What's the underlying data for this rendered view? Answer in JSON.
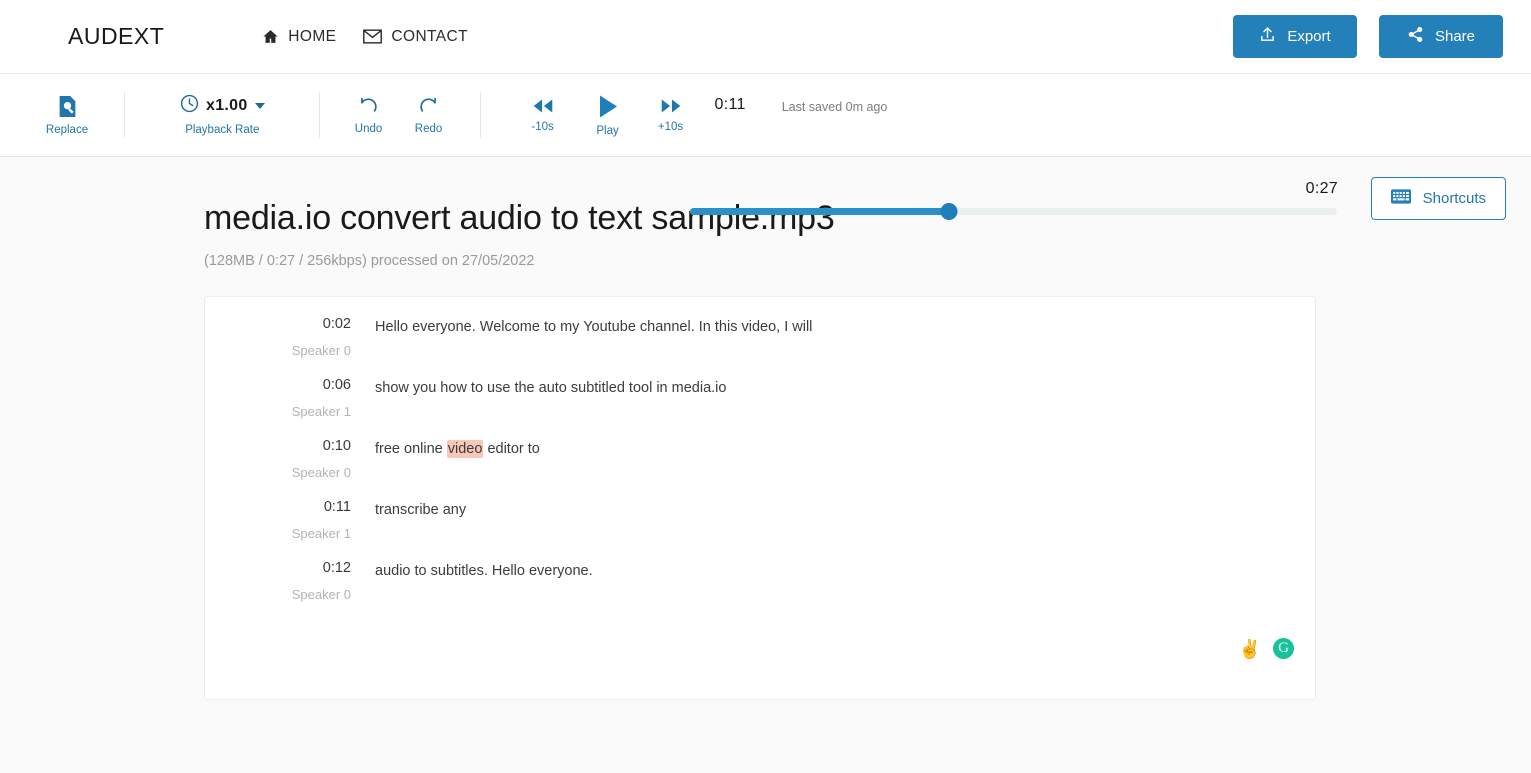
{
  "header": {
    "brand": "AUDEXT",
    "nav": [
      {
        "label": "HOME",
        "icon": "home-icon"
      },
      {
        "label": "CONTACT",
        "icon": "mail-icon"
      }
    ],
    "export_label": "Export",
    "share_label": "Share"
  },
  "toolbar": {
    "replace_label": "Replace",
    "playback_rate_value": "x1.00",
    "playback_rate_label": "Playback Rate",
    "undo_label": "Undo",
    "redo_label": "Redo",
    "back10_label": "-10s",
    "play_label": "Play",
    "forward10_label": "+10s",
    "current_time": "0:11",
    "total_time": "0:27",
    "saved_status": "Last saved 0m ago",
    "progress_percent": 40,
    "shortcuts_label": "Shortcuts"
  },
  "document": {
    "title": "media.io convert audio to text sample.mp3",
    "meta": "(128MB / 0:27 / 256kbps) processed on 27/05/2022"
  },
  "transcript": {
    "rows": [
      {
        "time": "0:02",
        "speaker": "Speaker 0",
        "text_before": "Hello everyone. Welcome to my Youtube channel. In this video, I will",
        "highlight": "",
        "text_after": ""
      },
      {
        "time": "0:06",
        "speaker": "Speaker 1",
        "text_before": "show you how to use the auto subtitled tool in media.io",
        "highlight": "",
        "text_after": ""
      },
      {
        "time": "0:10",
        "speaker": "Speaker 0",
        "text_before": "free online ",
        "highlight": "video",
        "text_after": " editor to"
      },
      {
        "time": "0:11",
        "speaker": "Speaker 1",
        "text_before": "transcribe any",
        "highlight": "",
        "text_after": ""
      },
      {
        "time": "0:12",
        "speaker": "Speaker 0",
        "text_before": "audio to subtitles. Hello everyone.",
        "highlight": "",
        "text_after": ""
      }
    ],
    "emoji": "✌",
    "grammarly_letter": "G"
  },
  "colors": {
    "accent_blue": "#2480b8",
    "progress_blue": "#2b8fc9",
    "highlight": "#f9c7b8",
    "grammarly_green": "#15c39a"
  }
}
